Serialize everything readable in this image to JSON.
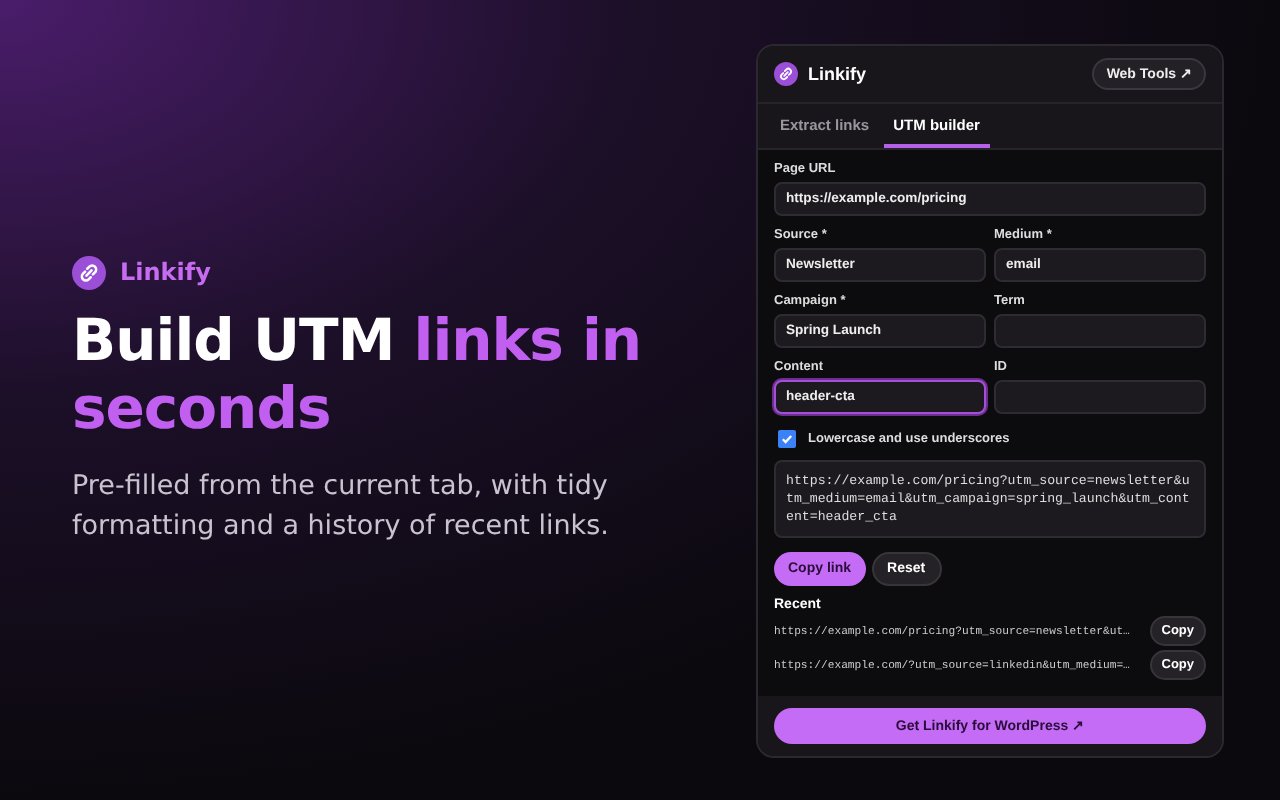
{
  "hero": {
    "brand": "Linkify",
    "title": "Build UTM ",
    "title_accent": "links in seconds",
    "subtitle": "Pre-filled from the current tab, with tidy formatting and a history of recent links."
  },
  "panel": {
    "title": "Linkify",
    "header_button": "Web Tools ↗",
    "tabs": [
      {
        "label": "Extract links",
        "selected": false
      },
      {
        "label": "UTM builder",
        "selected": true
      }
    ],
    "fields": [
      {
        "label": "Page URL",
        "value": "https://example.com/pricing",
        "focused": false,
        "wide": true
      },
      {
        "label": "Source *",
        "value": "Newsletter",
        "focused": false,
        "wide": false
      },
      {
        "label": "Medium *",
        "value": "email",
        "focused": false,
        "wide": false
      },
      {
        "label": "Campaign *",
        "value": "Spring Launch",
        "focused": false,
        "wide": false
      },
      {
        "label": "Term",
        "focused": false,
        "wide": false
      },
      {
        "label": "Content",
        "value": "header-cta",
        "focused": true,
        "wide": false
      },
      {
        "label": "ID",
        "focused": false,
        "wide": false
      }
    ],
    "option": {
      "label": "Lowercase and use underscores",
      "checked": true
    },
    "output": "https://example.com/pricing?utm_source=newsletter&utm_medium=email&utm_campaign=spring_launch&utm_content=header_cta",
    "buttons": [
      {
        "label": "Copy link",
        "kind": "primary"
      },
      {
        "label": "Reset",
        "kind": "secondary"
      }
    ],
    "recent_title": "Recent",
    "recent": [
      {
        "url": "https://example.com/pricing?utm_source=newsletter&ut…",
        "button": "Copy"
      },
      {
        "url": "https://example.com/?utm_source=linkedin&utm_medium=…",
        "button": "Copy"
      }
    ],
    "footer_button": "Get Linkify for WordPress ↗"
  }
}
